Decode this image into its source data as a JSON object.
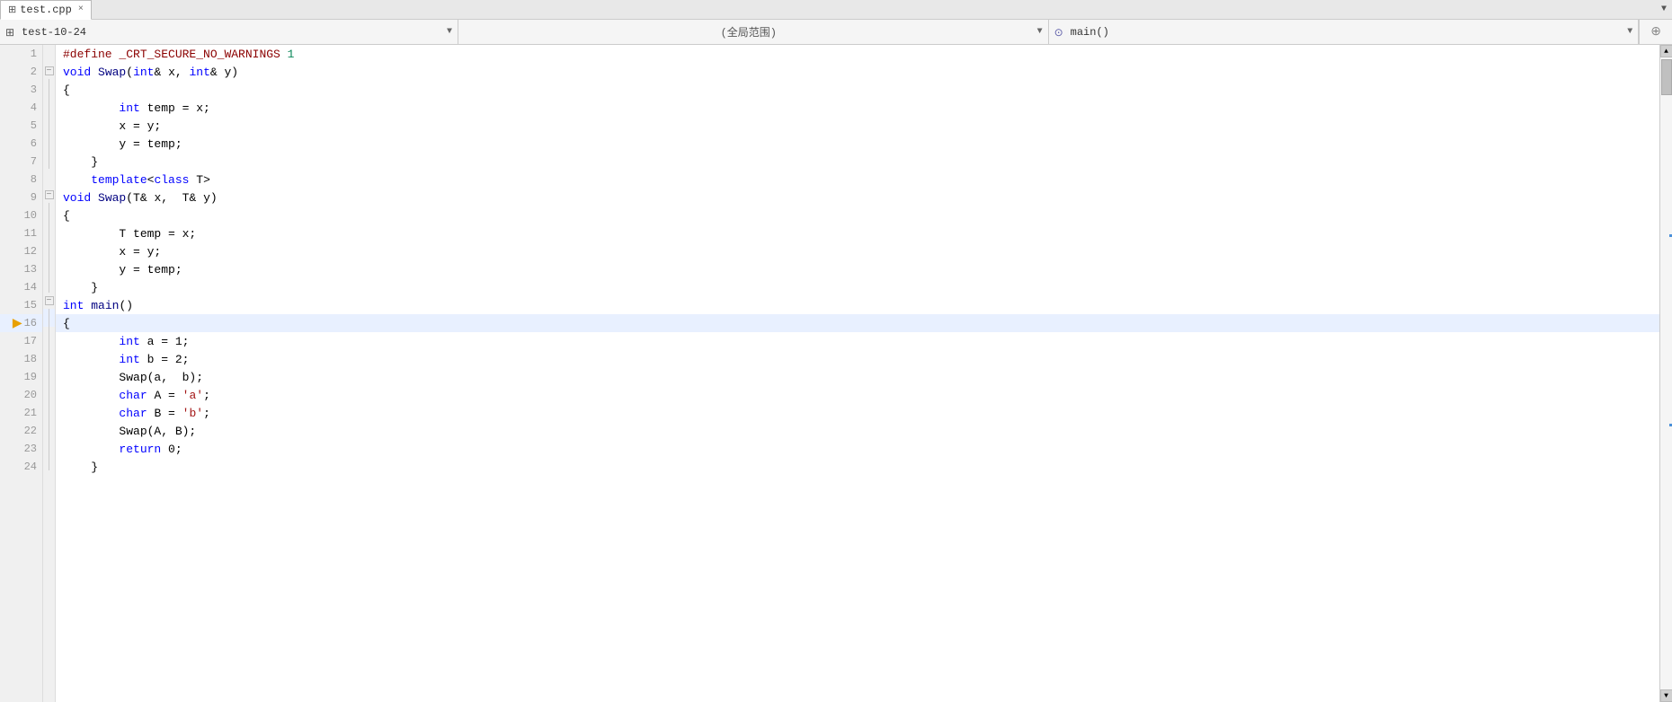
{
  "tab": {
    "filename": "test.cpp",
    "icon": "📄",
    "close_label": "×",
    "dropdown_label": "▼"
  },
  "toolbar": {
    "project_icon": "⊞",
    "project_name": "test-10-24",
    "project_dropdown": "▼",
    "scope_label": "(全局范围)",
    "scope_dropdown": "▼",
    "function_icon": "⊙",
    "function_label": "main()",
    "function_dropdown": "▼",
    "pin_label": "⊕"
  },
  "lines": [
    {
      "num": 1,
      "fold": "",
      "code": [
        {
          "t": "preprocessor",
          "v": "#define"
        },
        {
          "t": "plain",
          "v": " "
        },
        {
          "t": "macro",
          "v": "_CRT_SECURE_NO_WARNINGS"
        },
        {
          "t": "plain",
          "v": " "
        },
        {
          "t": "num",
          "v": "1"
        }
      ]
    },
    {
      "num": 2,
      "fold": "minus",
      "code": [
        {
          "t": "kw",
          "v": "void"
        },
        {
          "t": "plain",
          "v": " "
        },
        {
          "t": "fn",
          "v": "Swap"
        },
        {
          "t": "plain",
          "v": "("
        },
        {
          "t": "kw",
          "v": "int"
        },
        {
          "t": "plain",
          "v": "& x, "
        },
        {
          "t": "kw",
          "v": "int"
        },
        {
          "t": "plain",
          "v": "& y)"
        }
      ]
    },
    {
      "num": 3,
      "fold": "vline",
      "code": [
        {
          "t": "plain",
          "v": "{"
        }
      ]
    },
    {
      "num": 4,
      "fold": "vline",
      "code": [
        {
          "t": "plain",
          "v": "        "
        },
        {
          "t": "kw",
          "v": "int"
        },
        {
          "t": "plain",
          "v": " temp = x;"
        }
      ]
    },
    {
      "num": 5,
      "fold": "vline",
      "code": [
        {
          "t": "plain",
          "v": "        x = y;"
        }
      ]
    },
    {
      "num": 6,
      "fold": "vline",
      "code": [
        {
          "t": "plain",
          "v": "        y = temp;"
        }
      ]
    },
    {
      "num": 7,
      "fold": "vline",
      "code": [
        {
          "t": "plain",
          "v": "    }"
        }
      ]
    },
    {
      "num": 8,
      "fold": "",
      "code": [
        {
          "t": "plain",
          "v": "    "
        },
        {
          "t": "kw",
          "v": "template"
        },
        {
          "t": "plain",
          "v": "<"
        },
        {
          "t": "kw",
          "v": "class"
        },
        {
          "t": "plain",
          "v": " T>"
        }
      ]
    },
    {
      "num": 9,
      "fold": "minus",
      "code": [
        {
          "t": "kw",
          "v": "void"
        },
        {
          "t": "plain",
          "v": " "
        },
        {
          "t": "fn",
          "v": "Swap"
        },
        {
          "t": "plain",
          "v": "(T& x,  T& y)"
        }
      ]
    },
    {
      "num": 10,
      "fold": "vline",
      "code": [
        {
          "t": "plain",
          "v": "{"
        }
      ]
    },
    {
      "num": 11,
      "fold": "vline",
      "code": [
        {
          "t": "plain",
          "v": "        T temp = x;"
        }
      ]
    },
    {
      "num": 12,
      "fold": "vline",
      "code": [
        {
          "t": "plain",
          "v": "        x = y;"
        }
      ]
    },
    {
      "num": 13,
      "fold": "vline",
      "code": [
        {
          "t": "plain",
          "v": "        y = temp;"
        }
      ]
    },
    {
      "num": 14,
      "fold": "vline",
      "code": [
        {
          "t": "plain",
          "v": "    }"
        }
      ]
    },
    {
      "num": 15,
      "fold": "minus",
      "code": [
        {
          "t": "kw",
          "v": "int"
        },
        {
          "t": "plain",
          "v": " "
        },
        {
          "t": "fn",
          "v": "main"
        },
        {
          "t": "plain",
          "v": "()"
        }
      ]
    },
    {
      "num": 16,
      "fold": "vline",
      "code": [
        {
          "t": "plain",
          "v": "{"
        }
      ],
      "current": true
    },
    {
      "num": 17,
      "fold": "vline",
      "code": [
        {
          "t": "plain",
          "v": "        "
        },
        {
          "t": "kw",
          "v": "int"
        },
        {
          "t": "plain",
          "v": " a = 1;"
        }
      ]
    },
    {
      "num": 18,
      "fold": "vline",
      "code": [
        {
          "t": "plain",
          "v": "        "
        },
        {
          "t": "kw",
          "v": "int"
        },
        {
          "t": "plain",
          "v": " b = 2;"
        }
      ]
    },
    {
      "num": 19,
      "fold": "vline",
      "code": [
        {
          "t": "plain",
          "v": "        Swap(a,  b);"
        }
      ]
    },
    {
      "num": 20,
      "fold": "vline",
      "code": [
        {
          "t": "plain",
          "v": "        "
        },
        {
          "t": "kw",
          "v": "char"
        },
        {
          "t": "plain",
          "v": " A = "
        },
        {
          "t": "str",
          "v": "'a'"
        },
        {
          "t": "plain",
          "v": ";"
        }
      ]
    },
    {
      "num": 21,
      "fold": "vline",
      "code": [
        {
          "t": "plain",
          "v": "        "
        },
        {
          "t": "kw",
          "v": "char"
        },
        {
          "t": "plain",
          "v": " B = "
        },
        {
          "t": "str",
          "v": "'b'"
        },
        {
          "t": "plain",
          "v": ";"
        }
      ]
    },
    {
      "num": 22,
      "fold": "vline",
      "code": [
        {
          "t": "plain",
          "v": "        Swap(A, B);"
        }
      ]
    },
    {
      "num": 23,
      "fold": "vline",
      "code": [
        {
          "t": "plain",
          "v": "        "
        },
        {
          "t": "kw",
          "v": "return"
        },
        {
          "t": "plain",
          "v": " 0;"
        }
      ]
    },
    {
      "num": 24,
      "fold": "vline",
      "code": [
        {
          "t": "plain",
          "v": "    }"
        }
      ]
    }
  ],
  "scrollbar": {
    "up_arrow": "▲",
    "down_arrow": "▼",
    "blue_marker_top_percent": 28,
    "blue_marker2_top_percent": 58
  }
}
